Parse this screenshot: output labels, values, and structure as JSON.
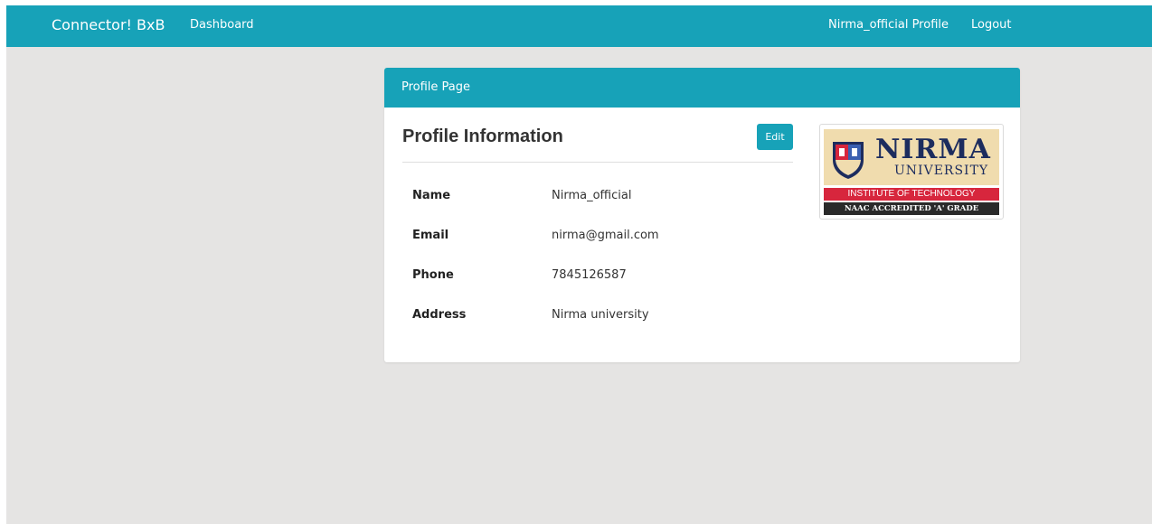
{
  "navbar": {
    "brand": "Connector! BxB",
    "dashboard": "Dashboard",
    "profile": "Nirma_official Profile",
    "logout": "Logout",
    "color": "#17a2b8"
  },
  "card": {
    "header_title": "Profile Page",
    "section_title": "Profile Information",
    "edit_label": "Edit",
    "fields": [
      {
        "label": "Name",
        "value": "Nirma_official"
      },
      {
        "label": "Email",
        "value": "nirma@gmail.com"
      },
      {
        "label": "Phone",
        "value": "7845126587"
      },
      {
        "label": "Address",
        "value": "Nirma university"
      }
    ]
  },
  "logo": {
    "word": "NIRMA",
    "sub": "UNIVERSITY",
    "band_red": "INSTITUTE OF TECHNOLOGY",
    "band_dark": "NAAC ACCREDITED 'A' GRADE"
  },
  "colors": {
    "background": "#e5e4e3",
    "accent": "#17a2b8",
    "logo_red": "#d7263d",
    "logo_navy": "#1c2c5e"
  }
}
